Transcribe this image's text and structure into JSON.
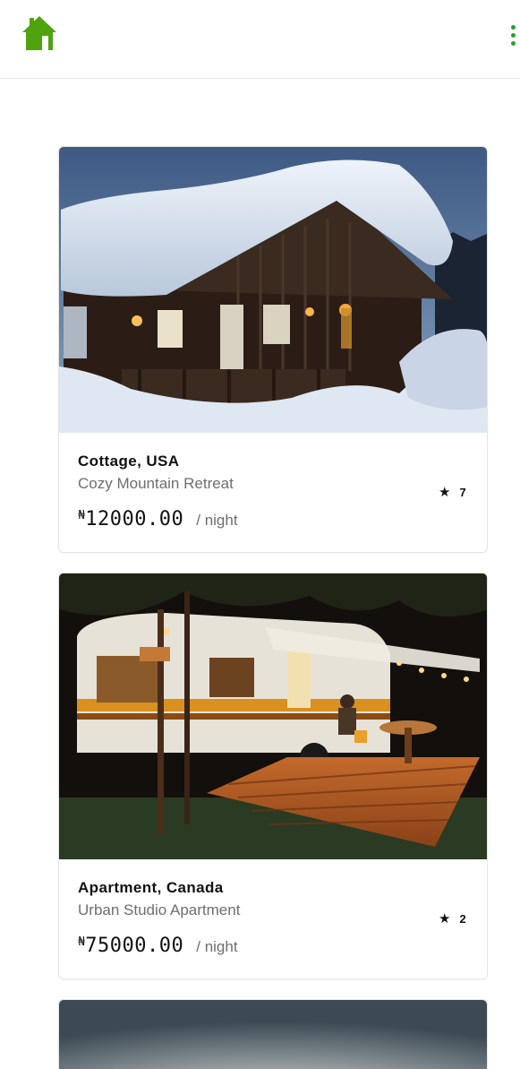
{
  "header": {
    "home_icon": "home-icon",
    "menu_icon": "vertical-ellipsis-icon",
    "accent_color": "#4ea30f",
    "menu_color": "#2e9e2e"
  },
  "listings": [
    {
      "title": "Cottage, USA",
      "subtitle": "Cozy Mountain Retreat",
      "rating": "7",
      "currency_symbol": "₦",
      "price": "12000.00",
      "unit": "/ night",
      "image": "snow-covered-cabin-at-dusk"
    },
    {
      "title": "Apartment, Canada",
      "subtitle": "Urban Studio Apartment",
      "rating": "2",
      "currency_symbol": "₦",
      "price": "75000.00",
      "unit": "/ night",
      "image": "camper-trailer-with-wooden-deck-at-night"
    },
    {
      "image": "sky-at-dusk"
    }
  ]
}
